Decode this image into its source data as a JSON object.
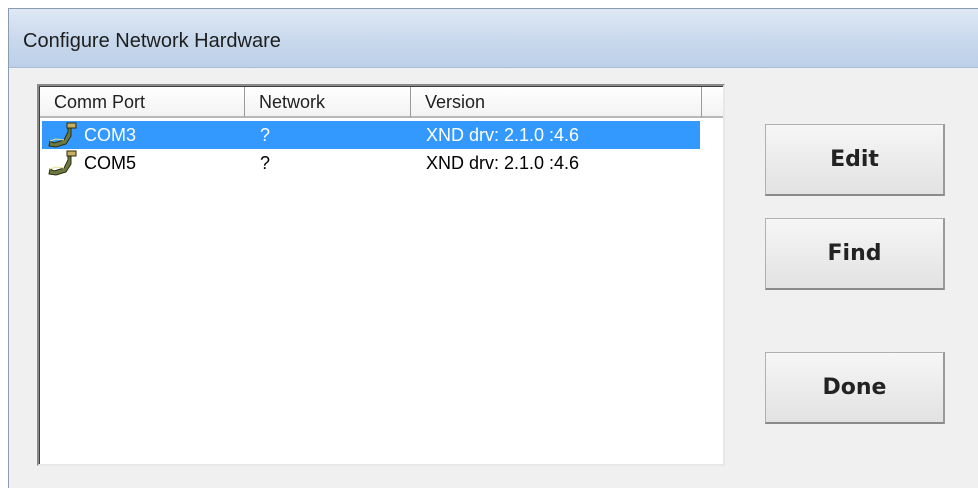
{
  "window": {
    "title": "Configure Network Hardware"
  },
  "list": {
    "columns": [
      "Comm Port",
      "Network",
      "Version"
    ],
    "rows": [
      {
        "port": "COM3",
        "network": "?",
        "version": "XND drv: 2.1.0 :4.6",
        "selected": true,
        "icon": "serial-port-icon"
      },
      {
        "port": "COM5",
        "network": "?",
        "version": "XND drv: 2.1.0 :4.6",
        "selected": false,
        "icon": "serial-port-icon"
      }
    ]
  },
  "buttons": {
    "edit": "Edit",
    "find": "Find",
    "done": "Done"
  },
  "colors": {
    "selection": "#3399ff",
    "selection_text": "#ffffff",
    "titlebar": "#c8d8ec",
    "window_bg": "#f0f0f0"
  }
}
